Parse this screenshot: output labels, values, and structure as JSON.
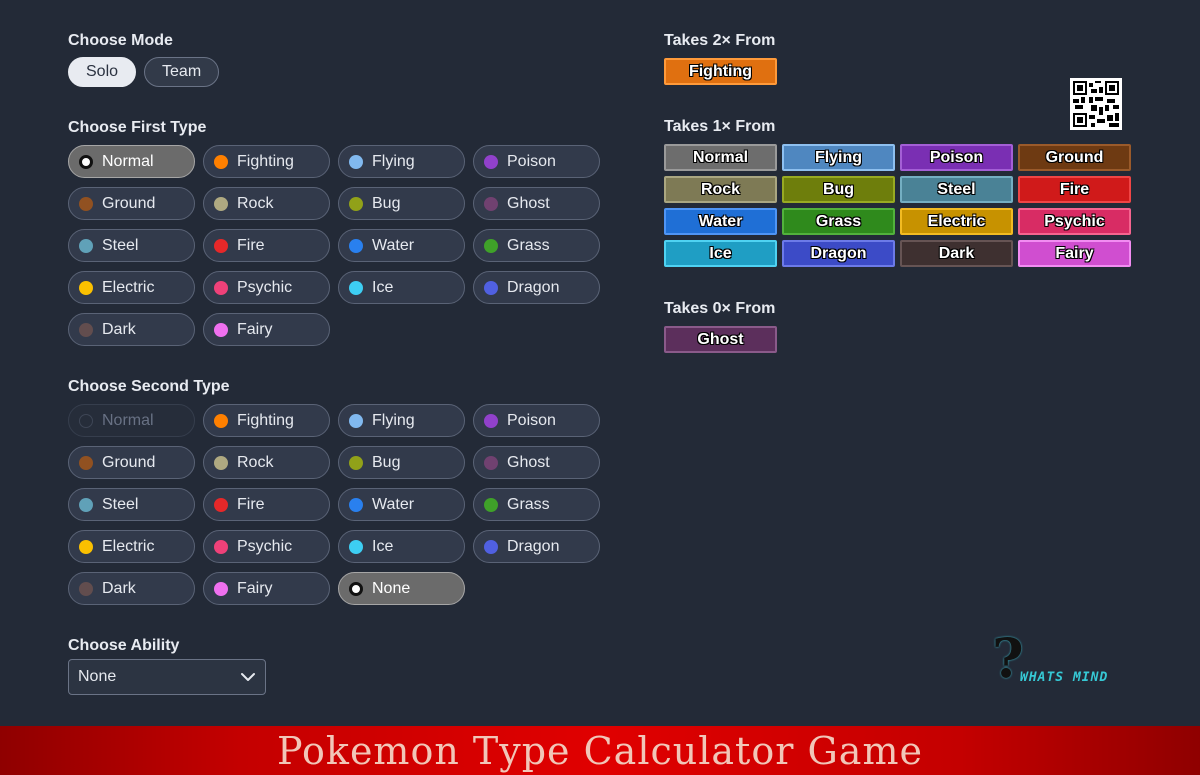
{
  "headings": {
    "mode": "Choose Mode",
    "first_type": "Choose First Type",
    "second_type": "Choose Second Type",
    "ability": "Choose Ability",
    "takes_2x": "Takes 2× From",
    "takes_1x": "Takes 1× From",
    "takes_0x": "Takes 0× From"
  },
  "mode": {
    "options": [
      "Solo",
      "Team"
    ],
    "selected": "Solo"
  },
  "first_type": {
    "selected": "Normal",
    "options": [
      {
        "label": "Normal",
        "color": "#ffffff"
      },
      {
        "label": "Fighting",
        "color": "#ff8000"
      },
      {
        "label": "Flying",
        "color": "#81b9ef"
      },
      {
        "label": "Poison",
        "color": "#9141cb"
      },
      {
        "label": "Ground",
        "color": "#915121"
      },
      {
        "label": "Rock",
        "color": "#afa981"
      },
      {
        "label": "Bug",
        "color": "#91a119"
      },
      {
        "label": "Ghost",
        "color": "#704170"
      },
      {
        "label": "Steel",
        "color": "#60a1b8"
      },
      {
        "label": "Fire",
        "color": "#e62829"
      },
      {
        "label": "Water",
        "color": "#2980ef"
      },
      {
        "label": "Grass",
        "color": "#3fa129"
      },
      {
        "label": "Electric",
        "color": "#fac000"
      },
      {
        "label": "Psychic",
        "color": "#ef4179"
      },
      {
        "label": "Ice",
        "color": "#3dcef3"
      },
      {
        "label": "Dragon",
        "color": "#5060e1"
      },
      {
        "label": "Dark",
        "color": "#624d4e"
      },
      {
        "label": "Fairy",
        "color": "#ef70ef"
      }
    ]
  },
  "second_type": {
    "selected": "None",
    "disabled": "Normal",
    "options": [
      {
        "label": "Normal",
        "color": "transparent"
      },
      {
        "label": "Fighting",
        "color": "#ff8000"
      },
      {
        "label": "Flying",
        "color": "#81b9ef"
      },
      {
        "label": "Poison",
        "color": "#9141cb"
      },
      {
        "label": "Ground",
        "color": "#915121"
      },
      {
        "label": "Rock",
        "color": "#afa981"
      },
      {
        "label": "Bug",
        "color": "#91a119"
      },
      {
        "label": "Ghost",
        "color": "#704170"
      },
      {
        "label": "Steel",
        "color": "#60a1b8"
      },
      {
        "label": "Fire",
        "color": "#e62829"
      },
      {
        "label": "Water",
        "color": "#2980ef"
      },
      {
        "label": "Grass",
        "color": "#3fa129"
      },
      {
        "label": "Electric",
        "color": "#fac000"
      },
      {
        "label": "Psychic",
        "color": "#ef4179"
      },
      {
        "label": "Ice",
        "color": "#3dcef3"
      },
      {
        "label": "Dragon",
        "color": "#5060e1"
      },
      {
        "label": "Dark",
        "color": "#624d4e"
      },
      {
        "label": "Fairy",
        "color": "#ef70ef"
      },
      {
        "label": "None",
        "color": "#ffffff"
      }
    ]
  },
  "ability": {
    "value": "None"
  },
  "results": {
    "takes_2x": [
      {
        "label": "Fighting",
        "bg": "#e07010",
        "border": "#ff9a3a"
      }
    ],
    "takes_1x": [
      {
        "label": "Normal",
        "bg": "#6d6d6d",
        "border": "#9a9a9a"
      },
      {
        "label": "Flying",
        "bg": "#4f87c0",
        "border": "#8ec0f0"
      },
      {
        "label": "Poison",
        "bg": "#7a2fb3",
        "border": "#a45fd6"
      },
      {
        "label": "Ground",
        "bg": "#6e3a12",
        "border": "#9a5a2a"
      },
      {
        "label": "Rock",
        "bg": "#7e7a55",
        "border": "#aaa681"
      },
      {
        "label": "Bug",
        "bg": "#6e7e0c",
        "border": "#98aa22"
      },
      {
        "label": "Steel",
        "bg": "#4a8296",
        "border": "#74aec2"
      },
      {
        "label": "Fire",
        "bg": "#d01a1a",
        "border": "#f04545"
      },
      {
        "label": "Water",
        "bg": "#1f6fd6",
        "border": "#4f95f5"
      },
      {
        "label": "Grass",
        "bg": "#2f8a1c",
        "border": "#52b23c"
      },
      {
        "label": "Electric",
        "bg": "#c79200",
        "border": "#f2bb22"
      },
      {
        "label": "Psychic",
        "bg": "#d82c64",
        "border": "#f5648f"
      },
      {
        "label": "Ice",
        "bg": "#1f9ec4",
        "border": "#4fd2f2"
      },
      {
        "label": "Dragon",
        "bg": "#3c4bc7",
        "border": "#6c7ae8"
      },
      {
        "label": "Dark",
        "bg": "#3e3030",
        "border": "#665454"
      },
      {
        "label": "Fairy",
        "bg": "#d04ed0",
        "border": "#f28cf2"
      }
    ],
    "takes_0x": [
      {
        "label": "Ghost",
        "bg": "#5c2f5c",
        "border": "#8a5a8a"
      }
    ]
  },
  "logo": {
    "text": "WHATS MIND"
  },
  "banner": {
    "title": "Pokemon Type Calculator Game",
    "color": "#e00000"
  }
}
